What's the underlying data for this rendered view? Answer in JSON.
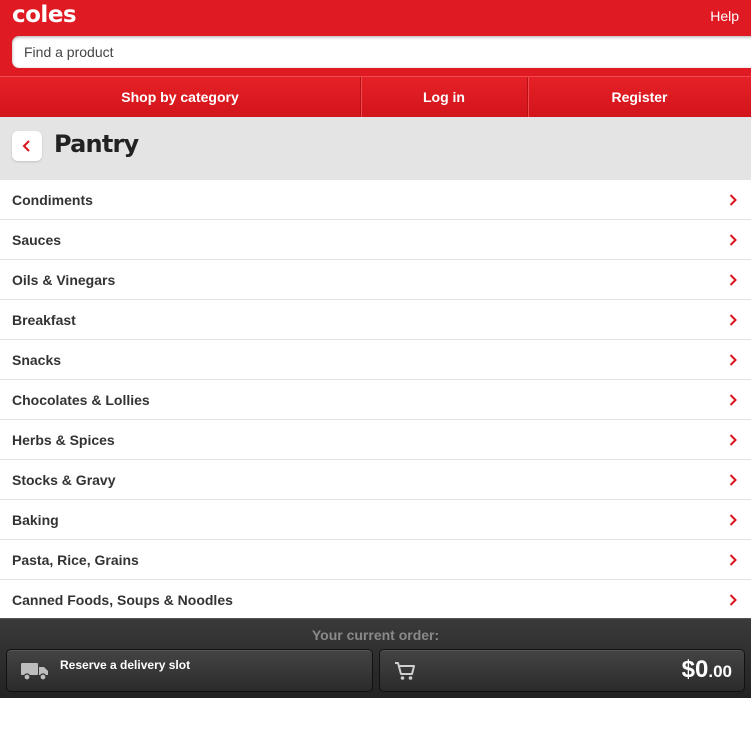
{
  "header": {
    "logo_text": "coles",
    "help_label": "Help",
    "search_placeholder": "Find a product",
    "search_value": ""
  },
  "nav": {
    "items": [
      {
        "label": "Shop by category"
      },
      {
        "label": "Log in"
      },
      {
        "label": "Register"
      }
    ]
  },
  "page": {
    "title": "Pantry",
    "back_icon": "chevron-left-icon"
  },
  "categories": [
    {
      "label": "Condiments"
    },
    {
      "label": "Sauces"
    },
    {
      "label": "Oils & Vinegars"
    },
    {
      "label": "Breakfast"
    },
    {
      "label": "Snacks"
    },
    {
      "label": "Chocolates & Lollies"
    },
    {
      "label": "Herbs & Spices"
    },
    {
      "label": "Stocks & Gravy"
    },
    {
      "label": "Baking"
    },
    {
      "label": "Pasta, Rice, Grains"
    },
    {
      "label": "Canned Foods, Soups & Noodles"
    }
  ],
  "footer": {
    "title": "Your current order:",
    "delivery_label": "Reserve a delivery slot",
    "delivery_icon": "truck-icon",
    "cart_icon": "cart-icon",
    "total_dollars": "$0",
    "total_cents": ".00"
  },
  "colors": {
    "brand_red": "#e01a22",
    "title_bar": "#e4e4e4",
    "footer_dark": "#2b2b2b",
    "chevron_red": "#d9141b"
  }
}
